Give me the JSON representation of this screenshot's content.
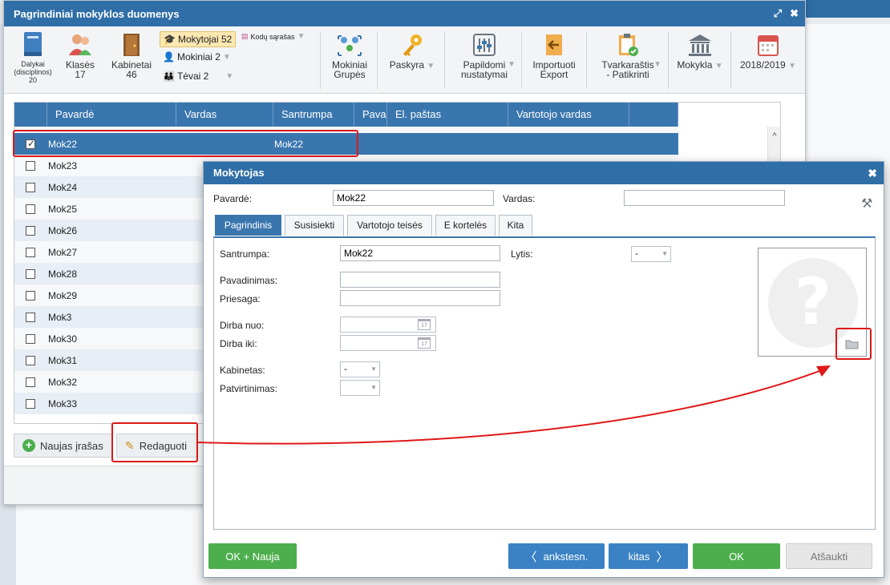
{
  "window": {
    "title": "Pagrindiniai mokyklos duomenys"
  },
  "ribbon": {
    "dalykai": {
      "label": "Dalykai (disciplinos)",
      "count": "20"
    },
    "klases": {
      "label": "Klasės",
      "count": "17"
    },
    "kabinetai": {
      "label": "Kabinetai",
      "count": "46"
    },
    "mokytojai": "Mokytojai 52",
    "mokiniai": "Mokiniai 2",
    "tevai": "Tėvai 2",
    "kodu_sarasas": "Kodų sąrašas",
    "mokiniai_grupes": "Mokiniai Grupės",
    "paskyra": "Paskyra",
    "papildomi_nustatymai": "Papildomi nustatymai",
    "import_export": "Importuoti Export",
    "tvarkarastis": "Tvarkaraštis - Patikrinti",
    "mokykla": "Mokykla",
    "metai": "2018/2019"
  },
  "grid": {
    "columns": [
      "Pavardė",
      "Vardas",
      "Santrumpa",
      "Pavad",
      "El. paštas",
      "Vartotojo vardas"
    ],
    "rows": [
      {
        "pavarde": "Mok22",
        "santrumpa": "Mok22",
        "checked": true
      },
      {
        "pavarde": "Mok23"
      },
      {
        "pavarde": "Mok24"
      },
      {
        "pavarde": "Mok25"
      },
      {
        "pavarde": "Mok26"
      },
      {
        "pavarde": "Mok27"
      },
      {
        "pavarde": "Mok28"
      },
      {
        "pavarde": "Mok29"
      },
      {
        "pavarde": "Mok3"
      },
      {
        "pavarde": "Mok30"
      },
      {
        "pavarde": "Mok31"
      },
      {
        "pavarde": "Mok32"
      },
      {
        "pavarde": "Mok33"
      }
    ]
  },
  "buttons": {
    "naujas": "Naujas įrašas",
    "redaguoti": "Redaguoti"
  },
  "dialog": {
    "title": "Mokytojas",
    "pavarde_label": "Pavardė:",
    "pavarde_value": "Mok22",
    "vardas_label": "Vardas:",
    "vardas_value": "",
    "tabs": [
      "Pagrindinis",
      "Susisiekti",
      "Vartotojo teisės",
      "E kortelės",
      "Kita"
    ],
    "santrumpa_label": "Santrumpa:",
    "santrumpa_value": "Mok22",
    "lytis_label": "Lytis:",
    "lytis_value": "-",
    "pavadinimas_label": "Pavadinimas:",
    "priesaga_label": "Priesaga:",
    "dirba_nuo_label": "Dirba nuo:",
    "dirba_iki_label": "Dirba iki:",
    "kabinetas_label": "Kabinetas:",
    "kabinetas_value": "-",
    "patvirtinimas_label": "Patvirtinimas:",
    "calendar_day": "17",
    "footer": {
      "ok_nauja": "OK + Nauja",
      "ankstesn": "ankstesn.",
      "kitas": "kitas",
      "ok": "OK",
      "atsaukti": "Atšaukti"
    }
  },
  "colors": {
    "header_blue": "#2f6ea6",
    "select_blue": "#3a76ae",
    "green": "#4cae4c",
    "annotation_red": "#e01818"
  }
}
